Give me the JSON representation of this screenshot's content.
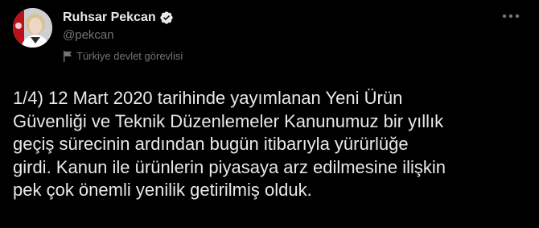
{
  "author": {
    "display_name": "Ruhsar Pekcan",
    "handle": "@pekcan",
    "verified": true,
    "avatar_icon": "profile-photo",
    "label_icon": "government-flag-icon",
    "label": "Türkiye devlet görevlisi"
  },
  "tweet": {
    "text": "1/4) 12 Mart 2020 tarihinde yayımlanan Yeni Ürün\nGüvenliği ve Teknik Düzenlemeler Kanunumuz bir yıllık\ngeçiş sürecinin ardından bugün itibarıyla yürürlüğe\ngirdi. Kanun ile ürünlerin piyasaya arz edilmesine ilişkin\npek çok önemli yenilik getirilmiş olduk."
  },
  "actions": {
    "more_icon": "more-options-icon"
  },
  "colors": {
    "background": "#000000",
    "primary_text": "#e7e9ea",
    "secondary_text": "#71767b",
    "verified_badge": "#e7e9ea"
  }
}
